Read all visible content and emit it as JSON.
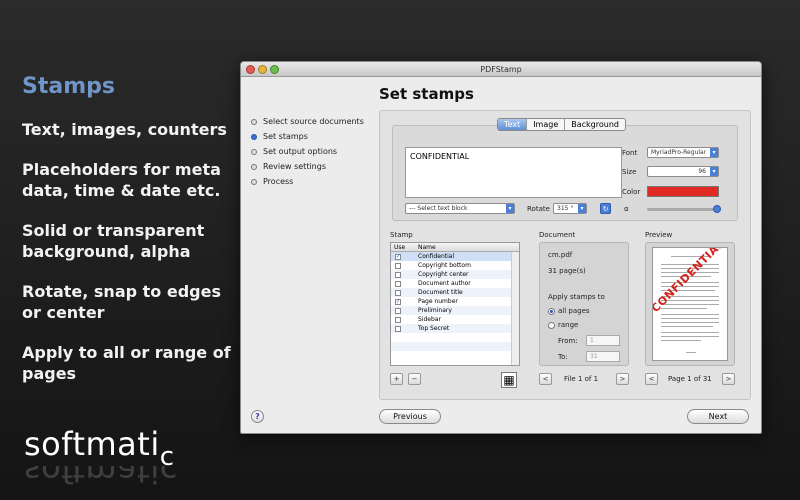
{
  "promo": {
    "title": "Stamps",
    "items": [
      "Text, images, counters",
      "Placeholders for meta data, time & date etc.",
      "Solid or transparent background, alpha",
      "Rotate, snap to edges or center",
      "Apply to all or range of pages"
    ],
    "brand": "softmati",
    "brand_sub": "c"
  },
  "window": {
    "title": "PDFStamp",
    "heading": "Set stamps",
    "steps": [
      "Select source documents",
      "Set stamps",
      "Set output options",
      "Review settings",
      "Process"
    ],
    "active_step": "Set stamps",
    "tabs": [
      "Text",
      "Image",
      "Background"
    ],
    "active_tab": "Text",
    "editor_text": "CONFIDENTIAL",
    "text_block_select": "--- Select text block",
    "rotate_label": "Rotate",
    "rotate_value": "315 °",
    "font_label": "Font",
    "font_value": "MyriadPro-Regular",
    "size_label": "Size",
    "size_value": "96",
    "color_label": "Color",
    "color_value": "#e22a24",
    "alpha_label": "α",
    "alpha_value": 1.0,
    "stamp_section": "Stamp",
    "stamp_headers": [
      "Use",
      "Name"
    ],
    "stamps": [
      {
        "name": "Confidential",
        "checked": true
      },
      {
        "name": "Copyright bottom",
        "checked": false
      },
      {
        "name": "Copyright center",
        "checked": false
      },
      {
        "name": "Document author",
        "checked": false
      },
      {
        "name": "Document title",
        "checked": false
      },
      {
        "name": "Page number",
        "checked": true
      },
      {
        "name": "Preliminary",
        "checked": false
      },
      {
        "name": "Sidebar",
        "checked": false
      },
      {
        "name": "Top Secret",
        "checked": false
      }
    ],
    "add_label": "+",
    "remove_label": "−",
    "document_section": "Document",
    "doc_name": "cm.pdf",
    "doc_pages": "31 page(s)",
    "apply_label": "Apply stamps to",
    "all_pages": "all pages",
    "range": "range",
    "from_label": "From:",
    "from_value": "1",
    "to_label": "To:",
    "to_value": "31",
    "file_nav": "File 1 of 1",
    "preview_section": "Preview",
    "preview_stamp": "CONFIDENTIAL",
    "page_nav": "Page 1 of 31",
    "prev_arrow": "<",
    "next_arrow": ">",
    "previous_button": "Previous",
    "next_button": "Next",
    "help": "?"
  }
}
